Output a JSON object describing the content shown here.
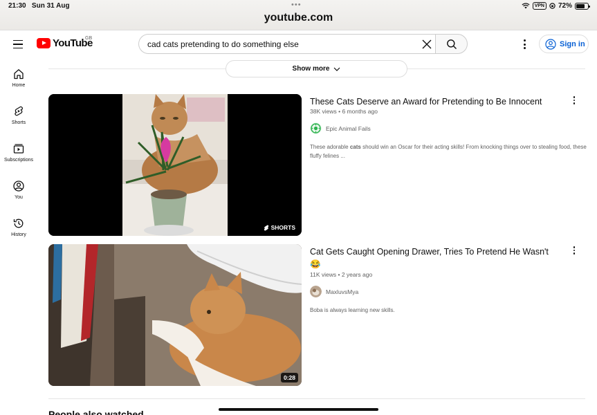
{
  "status": {
    "time": "21:30",
    "date": "Sun 31 Aug",
    "url": "youtube.com",
    "vpn": "VPN",
    "battery": "72%",
    "battery_level": 0.72
  },
  "header": {
    "logo_text": "YouTube",
    "region": "GB",
    "search_value": "cad cats pretending to do something else",
    "sign_in": "Sign in"
  },
  "nav": [
    {
      "label": "Home",
      "icon": "home-icon"
    },
    {
      "label": "Shorts",
      "icon": "shorts-icon"
    },
    {
      "label": "Subscriptions",
      "icon": "subscriptions-icon"
    },
    {
      "label": "You",
      "icon": "you-icon"
    },
    {
      "label": "History",
      "icon": "history-icon"
    }
  ],
  "show_more": "Show more",
  "videos": [
    {
      "title": "These Cats Deserve an Award for Pretending to Be Innocent",
      "title_extra": "",
      "views": "38K views",
      "age": "6 months ago",
      "channel": "Epic Animal Fails",
      "desc_pre": "These adorable ",
      "desc_bold": "cats",
      "desc_post": " should win an Oscar for their acting skills! From knocking things over to stealing food, these fluffy felines ...",
      "badge": "SHORTS"
    },
    {
      "title": "Cat Gets Caught Opening Drawer, Tries To Pretend He Wasn't",
      "title_extra": "😂",
      "views": "11K views",
      "age": "2 years ago",
      "channel": "MaxluvsMya",
      "desc_pre": "Boba is always learning new skills.",
      "desc_bold": "",
      "desc_post": "",
      "badge": "0:28"
    }
  ],
  "section_title": "People also watched",
  "colors": {
    "brand": "#ff0000",
    "link": "#065fd4",
    "meta": "#606060"
  }
}
